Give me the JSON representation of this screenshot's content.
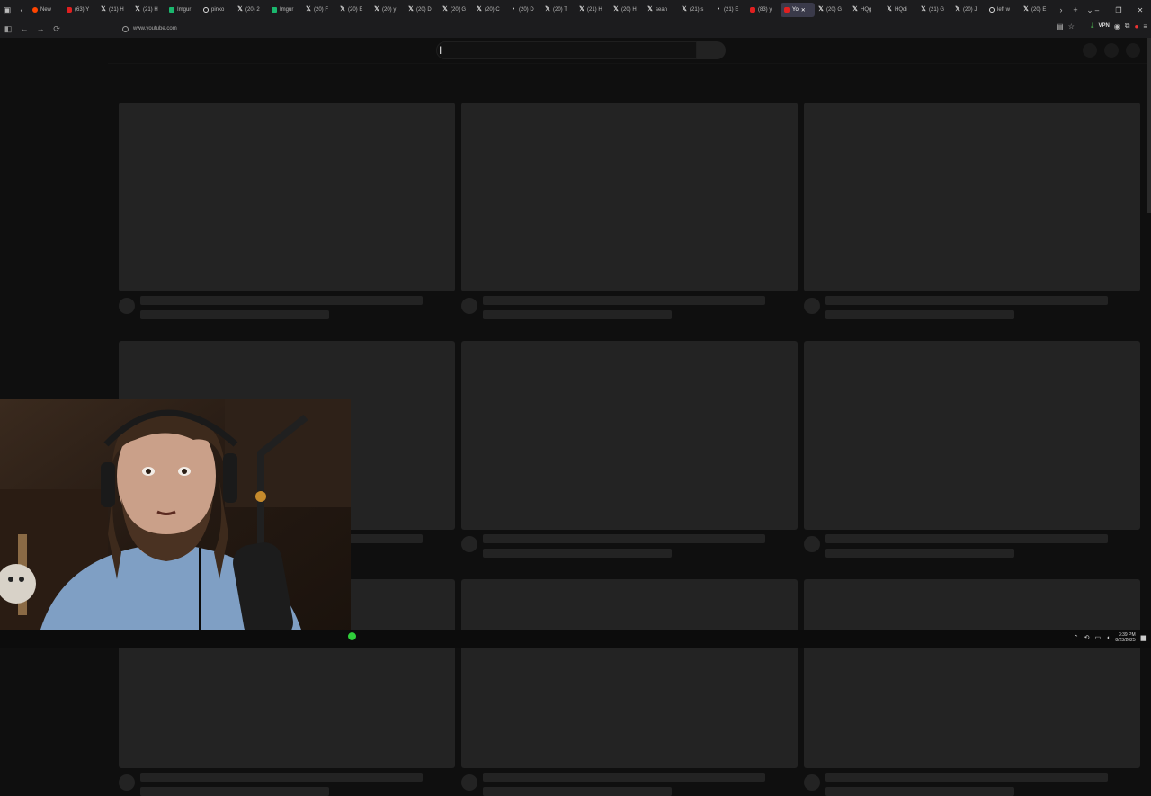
{
  "browser": {
    "tabs": [
      {
        "icon": "reddit-icon",
        "label": "New"
      },
      {
        "icon": "youtube-icon",
        "label": "(63) Y"
      },
      {
        "icon": "x-icon",
        "label": "(21) H"
      },
      {
        "icon": "x-icon",
        "label": "(21) H"
      },
      {
        "icon": "imgur-icon",
        "label": "Imgur"
      },
      {
        "icon": "globe-icon",
        "label": "pinko"
      },
      {
        "icon": "x-icon",
        "label": "(20) 2"
      },
      {
        "icon": "imgur-icon",
        "label": "Imgur"
      },
      {
        "icon": "x-icon",
        "label": "(20) F"
      },
      {
        "icon": "x-icon",
        "label": "(20) E"
      },
      {
        "icon": "x-icon",
        "label": "(20) y"
      },
      {
        "icon": "x-icon",
        "label": "(20) D"
      },
      {
        "icon": "x-icon",
        "label": "(20) G"
      },
      {
        "icon": "x-icon",
        "label": "(20) C"
      },
      {
        "icon": "dot-icon",
        "label": "(20) D"
      },
      {
        "icon": "x-icon",
        "label": "(20) T"
      },
      {
        "icon": "x-icon",
        "label": "(21) H"
      },
      {
        "icon": "x-icon",
        "label": "(20) H"
      },
      {
        "icon": "x-icon",
        "label": "sean"
      },
      {
        "icon": "x-icon",
        "label": "(21) s"
      },
      {
        "icon": "dot-icon",
        "label": "(21) E"
      },
      {
        "icon": "youtube-icon",
        "label": "(83) y"
      },
      {
        "icon": "youtube-icon",
        "label": "Yo",
        "active": true
      },
      {
        "icon": "x-icon",
        "label": "(20) G"
      },
      {
        "icon": "x-icon",
        "label": "HQg"
      },
      {
        "icon": "x-icon",
        "label": "HQdi"
      },
      {
        "icon": "x-icon",
        "label": "(21) G"
      },
      {
        "icon": "x-icon",
        "label": "(20) J"
      },
      {
        "icon": "globe-icon",
        "label": "left w"
      },
      {
        "icon": "x-icon",
        "label": "(20) E"
      }
    ],
    "url": "www.youtube.com",
    "vpn_label": "VPN"
  },
  "taskbar": {
    "time": "3:39 PM",
    "date": "8/23/2025"
  },
  "colors": {
    "page_bg": "#0f0f0f",
    "skeleton": "#232323",
    "active_tab": "#3a3a4a"
  }
}
